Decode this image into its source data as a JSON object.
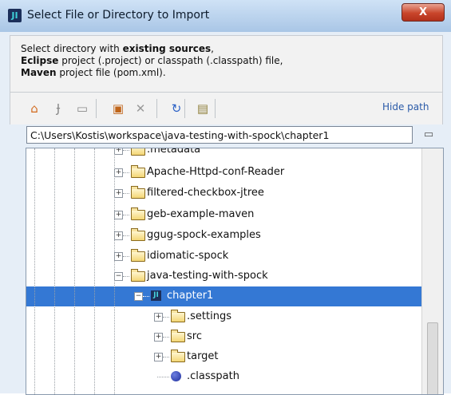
{
  "window": {
    "title": "Select File or Directory to Import",
    "close_label": "X"
  },
  "description": {
    "line1_prefix": "Select directory with ",
    "line1_bold": "existing sources",
    "line1_suffix": ",",
    "line2_bold": "Eclipse",
    "line2_rest": " project (.project) or classpath (.classpath) file,",
    "line3_bold": "Maven",
    "line3_rest": " project file (pom.xml)."
  },
  "toolbar": {
    "buttons": [
      {
        "name": "home-icon",
        "glyph": "⌂",
        "color": "#d26a1e"
      },
      {
        "name": "project-icon",
        "glyph": "Ɉ",
        "color": "#8a8a8a"
      },
      {
        "name": "module-icon",
        "glyph": "▭",
        "color": "#8a8a8a"
      },
      {
        "name": "new-folder-icon",
        "glyph": "▣",
        "color": "#c0651a"
      },
      {
        "name": "delete-icon",
        "glyph": "✕",
        "color": "#9a9a9a"
      },
      {
        "name": "refresh-icon",
        "glyph": "↻",
        "color": "#2b61c6"
      },
      {
        "name": "show-hidden-icon",
        "glyph": "▤",
        "color": "#8f7f3a"
      }
    ],
    "hide_path_label": "Hide path"
  },
  "path": {
    "value": "C:\\Users\\Kostis\\workspace\\java-testing-with-spock\\chapter1",
    "icon": "path-browse-icon"
  },
  "tree": {
    "items": [
      {
        "label": ".metadata",
        "type": "folder",
        "expander": "+"
      },
      {
        "label": "Apache-Httpd-conf-Reader",
        "type": "folder",
        "expander": "+"
      },
      {
        "label": "filtered-checkbox-jtree",
        "type": "folder",
        "expander": "+"
      },
      {
        "label": "geb-example-maven",
        "type": "folder",
        "expander": "+"
      },
      {
        "label": "ggug-spock-examples",
        "type": "folder",
        "expander": "+"
      },
      {
        "label": "idiomatic-spock",
        "type": "folder",
        "expander": "+"
      },
      {
        "label": "java-testing-with-spock",
        "type": "folder",
        "expander": "−"
      },
      {
        "label": "chapter1",
        "type": "module",
        "expander": "−",
        "selected": true
      },
      {
        "label": ".settings",
        "type": "folder",
        "expander": "+"
      },
      {
        "label": "src",
        "type": "folder",
        "expander": "+"
      },
      {
        "label": "target",
        "type": "folder",
        "expander": "+"
      },
      {
        "label": ".classpath",
        "type": "file",
        "expander": ""
      }
    ]
  },
  "colors": {
    "selection": "#3478d4",
    "link": "#2a5aa8"
  }
}
